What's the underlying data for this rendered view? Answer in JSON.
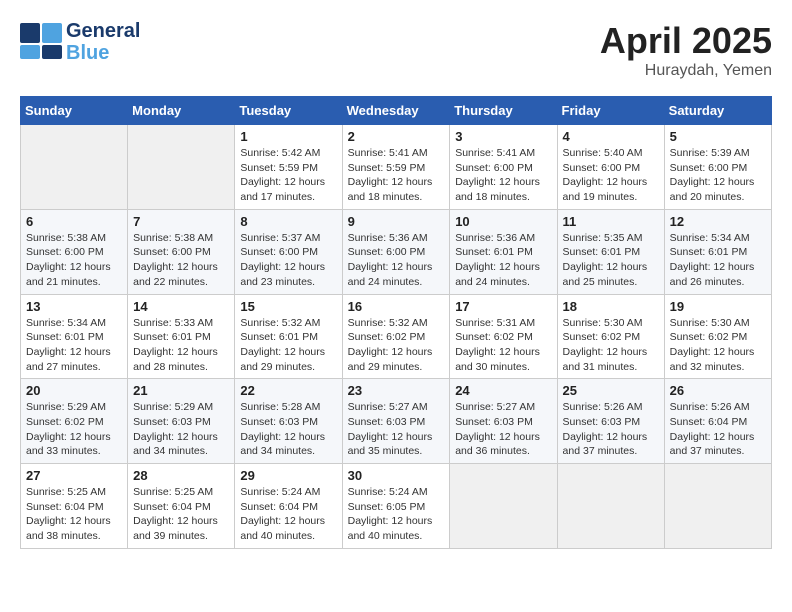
{
  "logo": {
    "line1": "General",
    "line2": "Blue"
  },
  "header": {
    "month": "April 2025",
    "location": "Huraydah, Yemen"
  },
  "days_of_week": [
    "Sunday",
    "Monday",
    "Tuesday",
    "Wednesday",
    "Thursday",
    "Friday",
    "Saturday"
  ],
  "weeks": [
    [
      {
        "day": "",
        "sunrise": "",
        "sunset": "",
        "daylight": ""
      },
      {
        "day": "",
        "sunrise": "",
        "sunset": "",
        "daylight": ""
      },
      {
        "day": "1",
        "sunrise": "Sunrise: 5:42 AM",
        "sunset": "Sunset: 5:59 PM",
        "daylight": "Daylight: 12 hours and 17 minutes."
      },
      {
        "day": "2",
        "sunrise": "Sunrise: 5:41 AM",
        "sunset": "Sunset: 5:59 PM",
        "daylight": "Daylight: 12 hours and 18 minutes."
      },
      {
        "day": "3",
        "sunrise": "Sunrise: 5:41 AM",
        "sunset": "Sunset: 6:00 PM",
        "daylight": "Daylight: 12 hours and 18 minutes."
      },
      {
        "day": "4",
        "sunrise": "Sunrise: 5:40 AM",
        "sunset": "Sunset: 6:00 PM",
        "daylight": "Daylight: 12 hours and 19 minutes."
      },
      {
        "day": "5",
        "sunrise": "Sunrise: 5:39 AM",
        "sunset": "Sunset: 6:00 PM",
        "daylight": "Daylight: 12 hours and 20 minutes."
      }
    ],
    [
      {
        "day": "6",
        "sunrise": "Sunrise: 5:38 AM",
        "sunset": "Sunset: 6:00 PM",
        "daylight": "Daylight: 12 hours and 21 minutes."
      },
      {
        "day": "7",
        "sunrise": "Sunrise: 5:38 AM",
        "sunset": "Sunset: 6:00 PM",
        "daylight": "Daylight: 12 hours and 22 minutes."
      },
      {
        "day": "8",
        "sunrise": "Sunrise: 5:37 AM",
        "sunset": "Sunset: 6:00 PM",
        "daylight": "Daylight: 12 hours and 23 minutes."
      },
      {
        "day": "9",
        "sunrise": "Sunrise: 5:36 AM",
        "sunset": "Sunset: 6:00 PM",
        "daylight": "Daylight: 12 hours and 24 minutes."
      },
      {
        "day": "10",
        "sunrise": "Sunrise: 5:36 AM",
        "sunset": "Sunset: 6:01 PM",
        "daylight": "Daylight: 12 hours and 24 minutes."
      },
      {
        "day": "11",
        "sunrise": "Sunrise: 5:35 AM",
        "sunset": "Sunset: 6:01 PM",
        "daylight": "Daylight: 12 hours and 25 minutes."
      },
      {
        "day": "12",
        "sunrise": "Sunrise: 5:34 AM",
        "sunset": "Sunset: 6:01 PM",
        "daylight": "Daylight: 12 hours and 26 minutes."
      }
    ],
    [
      {
        "day": "13",
        "sunrise": "Sunrise: 5:34 AM",
        "sunset": "Sunset: 6:01 PM",
        "daylight": "Daylight: 12 hours and 27 minutes."
      },
      {
        "day": "14",
        "sunrise": "Sunrise: 5:33 AM",
        "sunset": "Sunset: 6:01 PM",
        "daylight": "Daylight: 12 hours and 28 minutes."
      },
      {
        "day": "15",
        "sunrise": "Sunrise: 5:32 AM",
        "sunset": "Sunset: 6:01 PM",
        "daylight": "Daylight: 12 hours and 29 minutes."
      },
      {
        "day": "16",
        "sunrise": "Sunrise: 5:32 AM",
        "sunset": "Sunset: 6:02 PM",
        "daylight": "Daylight: 12 hours and 29 minutes."
      },
      {
        "day": "17",
        "sunrise": "Sunrise: 5:31 AM",
        "sunset": "Sunset: 6:02 PM",
        "daylight": "Daylight: 12 hours and 30 minutes."
      },
      {
        "day": "18",
        "sunrise": "Sunrise: 5:30 AM",
        "sunset": "Sunset: 6:02 PM",
        "daylight": "Daylight: 12 hours and 31 minutes."
      },
      {
        "day": "19",
        "sunrise": "Sunrise: 5:30 AM",
        "sunset": "Sunset: 6:02 PM",
        "daylight": "Daylight: 12 hours and 32 minutes."
      }
    ],
    [
      {
        "day": "20",
        "sunrise": "Sunrise: 5:29 AM",
        "sunset": "Sunset: 6:02 PM",
        "daylight": "Daylight: 12 hours and 33 minutes."
      },
      {
        "day": "21",
        "sunrise": "Sunrise: 5:29 AM",
        "sunset": "Sunset: 6:03 PM",
        "daylight": "Daylight: 12 hours and 34 minutes."
      },
      {
        "day": "22",
        "sunrise": "Sunrise: 5:28 AM",
        "sunset": "Sunset: 6:03 PM",
        "daylight": "Daylight: 12 hours and 34 minutes."
      },
      {
        "day": "23",
        "sunrise": "Sunrise: 5:27 AM",
        "sunset": "Sunset: 6:03 PM",
        "daylight": "Daylight: 12 hours and 35 minutes."
      },
      {
        "day": "24",
        "sunrise": "Sunrise: 5:27 AM",
        "sunset": "Sunset: 6:03 PM",
        "daylight": "Daylight: 12 hours and 36 minutes."
      },
      {
        "day": "25",
        "sunrise": "Sunrise: 5:26 AM",
        "sunset": "Sunset: 6:03 PM",
        "daylight": "Daylight: 12 hours and 37 minutes."
      },
      {
        "day": "26",
        "sunrise": "Sunrise: 5:26 AM",
        "sunset": "Sunset: 6:04 PM",
        "daylight": "Daylight: 12 hours and 37 minutes."
      }
    ],
    [
      {
        "day": "27",
        "sunrise": "Sunrise: 5:25 AM",
        "sunset": "Sunset: 6:04 PM",
        "daylight": "Daylight: 12 hours and 38 minutes."
      },
      {
        "day": "28",
        "sunrise": "Sunrise: 5:25 AM",
        "sunset": "Sunset: 6:04 PM",
        "daylight": "Daylight: 12 hours and 39 minutes."
      },
      {
        "day": "29",
        "sunrise": "Sunrise: 5:24 AM",
        "sunset": "Sunset: 6:04 PM",
        "daylight": "Daylight: 12 hours and 40 minutes."
      },
      {
        "day": "30",
        "sunrise": "Sunrise: 5:24 AM",
        "sunset": "Sunset: 6:05 PM",
        "daylight": "Daylight: 12 hours and 40 minutes."
      },
      {
        "day": "",
        "sunrise": "",
        "sunset": "",
        "daylight": ""
      },
      {
        "day": "",
        "sunrise": "",
        "sunset": "",
        "daylight": ""
      },
      {
        "day": "",
        "sunrise": "",
        "sunset": "",
        "daylight": ""
      }
    ]
  ]
}
